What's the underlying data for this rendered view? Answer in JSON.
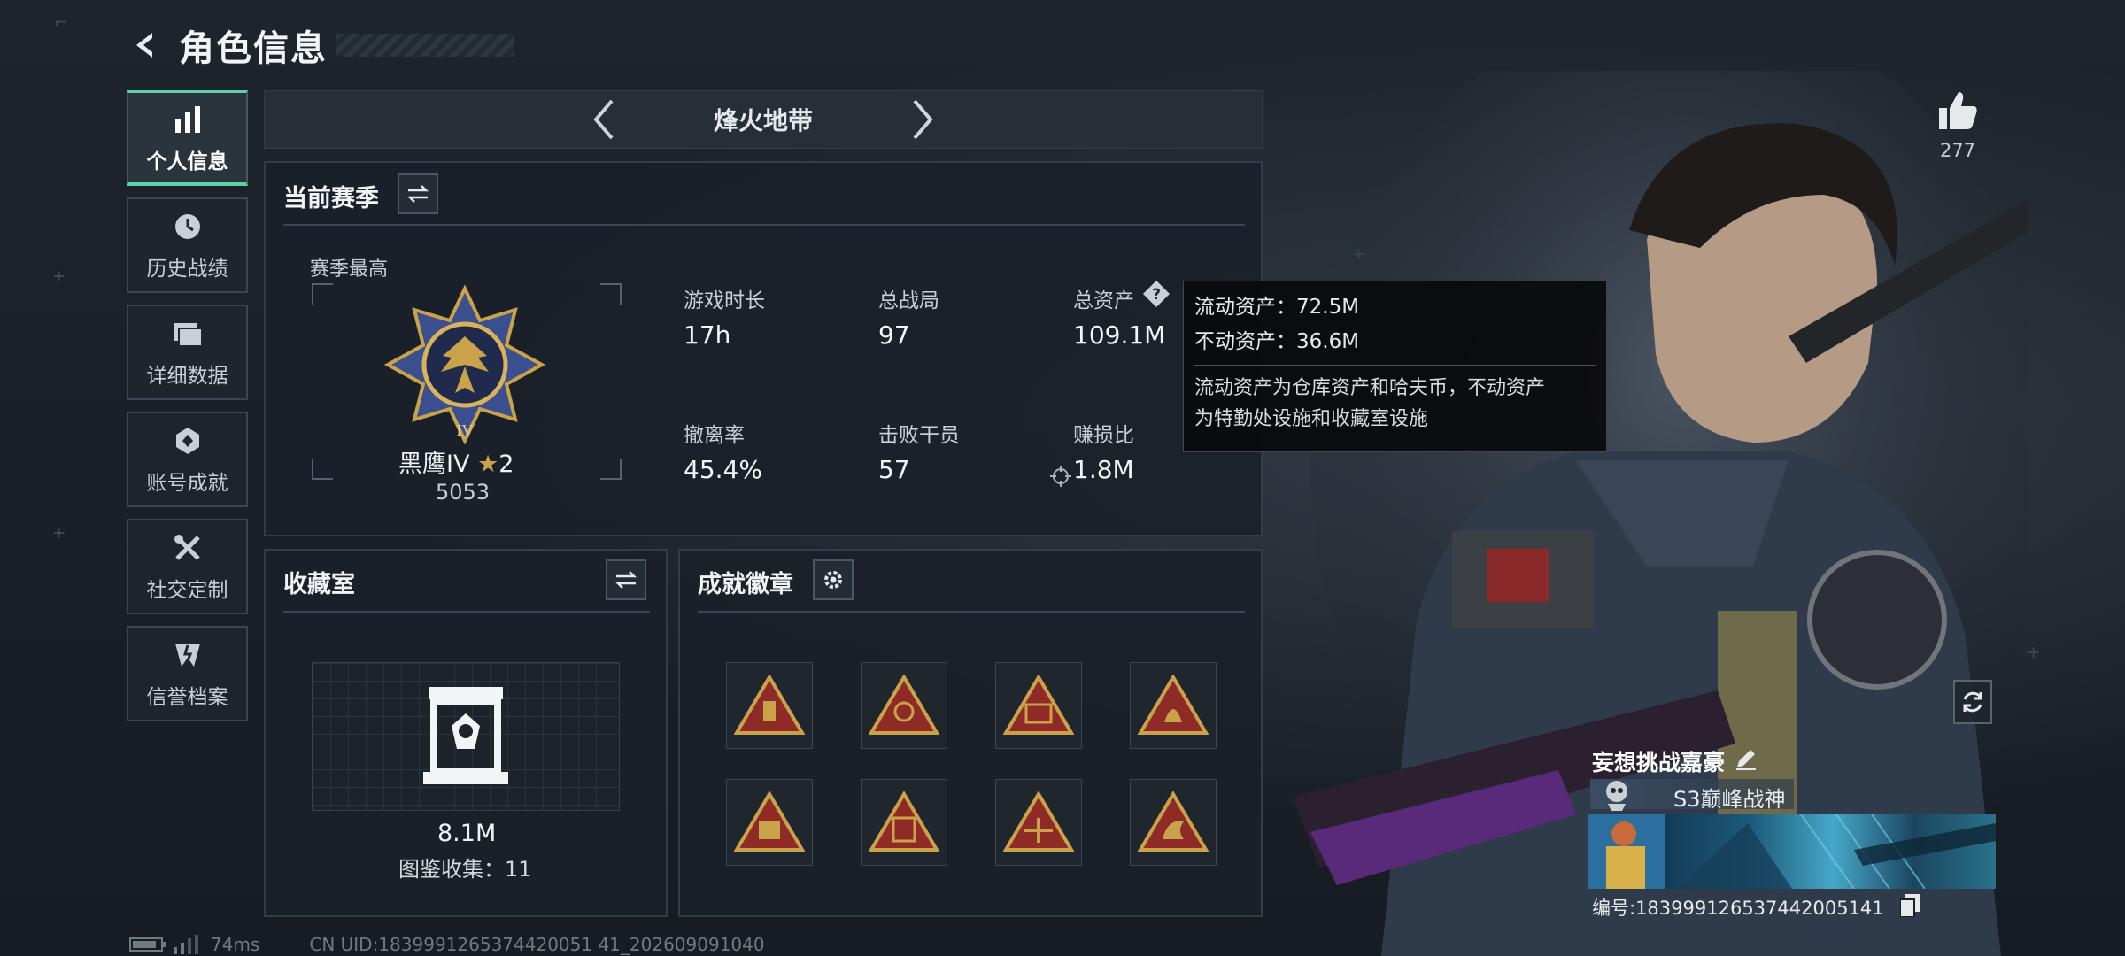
{
  "header": {
    "title": "角色信息"
  },
  "nav": {
    "items": [
      {
        "label": "个人信息",
        "icon": "bar-chart-icon",
        "active": true
      },
      {
        "label": "历史战绩",
        "icon": "clock-icon"
      },
      {
        "label": "详细数据",
        "icon": "folder-icon"
      },
      {
        "label": "账号成就",
        "icon": "achievement-icon"
      },
      {
        "label": "社交定制",
        "icon": "tools-icon"
      },
      {
        "label": "信誉档案",
        "icon": "reputation-icon"
      }
    ]
  },
  "mode": {
    "title": "烽火地带"
  },
  "season": {
    "title": "当前赛季",
    "best_label": "赛季最高",
    "rank_name": "黑鹰IV",
    "rank_stars": "2",
    "rank_score": "5053",
    "stats": [
      {
        "label": "游戏时长",
        "value": "17h"
      },
      {
        "label": "总战局",
        "value": "97"
      },
      {
        "label": "总资产",
        "value": "109.1M"
      },
      {
        "label": "撤离率",
        "value": "45.4%"
      },
      {
        "label": "击败干员",
        "value": "57"
      },
      {
        "label": "赚损比",
        "value": "1.8M"
      }
    ]
  },
  "tooltip": {
    "liquid": "流动资产：72.5M",
    "fixed": "不动资产：36.6M",
    "desc_line1": "流动资产为仓库资产和哈夫币，不动资产",
    "desc_line2": "为特勤处设施和收藏室设施"
  },
  "collection": {
    "title": "收藏室",
    "value": "8.1M",
    "count": "图鉴收集：11"
  },
  "badges": {
    "title": "成就徽章",
    "items": [
      "badge-1",
      "badge-2",
      "badge-3",
      "badge-4",
      "badge-5",
      "badge-6",
      "badge-7",
      "badge-8"
    ]
  },
  "likes": {
    "count": "277"
  },
  "player": {
    "name": "妄想挑战嘉豪",
    "title": "S3巅峰战神",
    "uid_line": "编号:18399912653744200514​1"
  },
  "footer": {
    "ping": "74ms",
    "uid": "CN UID:1839991265374420051 41_202609091040"
  },
  "colors": {
    "accent": "#5fd1a8",
    "gold": "#c9a24a",
    "badge_red": "#8e2b26"
  }
}
